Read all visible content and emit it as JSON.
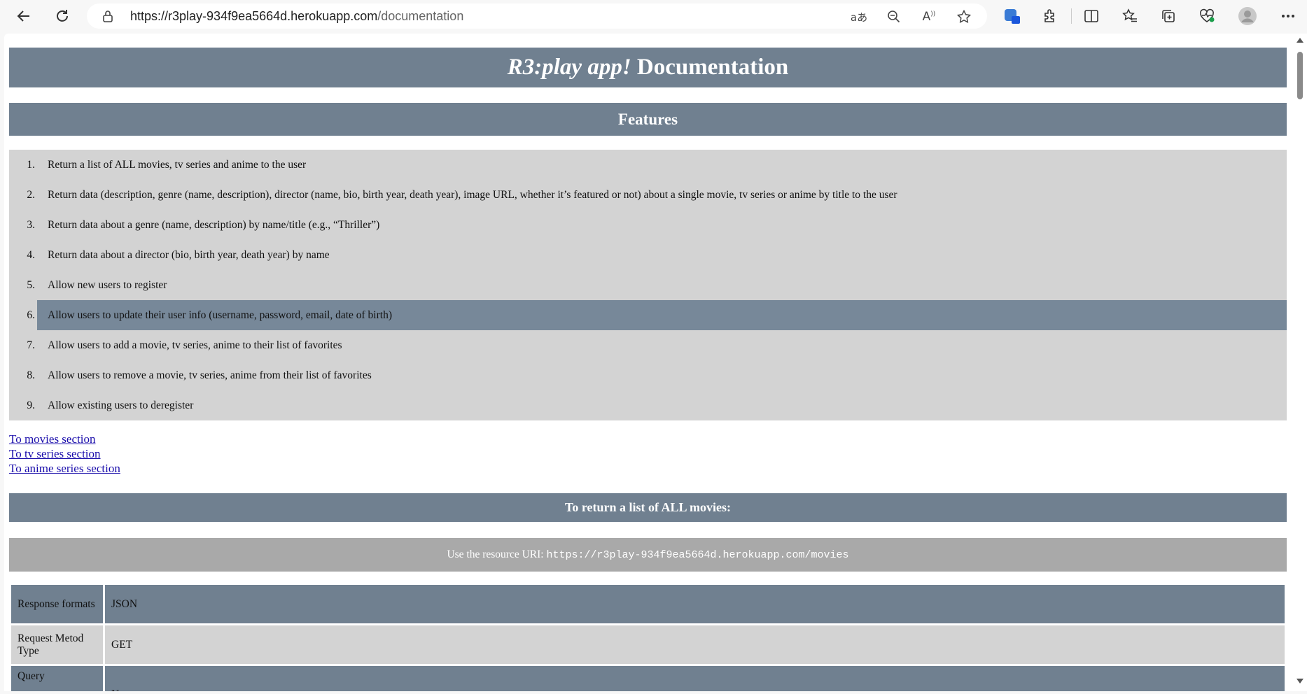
{
  "browser": {
    "url_host": "https://r3play-934f9ea5664d.herokuapp.com",
    "url_path": "/documentation"
  },
  "page": {
    "title_italic": "R3:play app!",
    "title_rest": " Documentation",
    "features_heading": "Features",
    "features": [
      {
        "num": "1.",
        "text": "Return a list of ALL movies, tv series and anime to the user"
      },
      {
        "num": "2.",
        "text": "Return data (description, genre (name, description), director (name, bio, birth year, death year), image URL, whether it’s featured or not) about a single movie, tv series or anime by title to the user"
      },
      {
        "num": "3.",
        "text": "Return data about a genre (name, description) by name/title (e.g., “Thriller”)"
      },
      {
        "num": "4.",
        "text": "Return data about a director (bio, birth year, death year) by name"
      },
      {
        "num": "5.",
        "text": "Allow new users to register"
      },
      {
        "num": "6.",
        "text": "Allow users to update their user info (username, password, email, date of birth)"
      },
      {
        "num": "7.",
        "text": "Allow users to add a movie, tv series, anime to their list of favorites"
      },
      {
        "num": "8.",
        "text": "Allow users to remove a movie, tv series, anime from their list of favorites"
      },
      {
        "num": "9.",
        "text": "Allow existing users to deregister"
      }
    ],
    "links": [
      "To movies section",
      "To tv series section",
      "To anime series section"
    ],
    "section_heading": "To return a list of ALL movies:",
    "uri_label": "Use the resource URI: ",
    "uri_value": "https://r3play-934f9ea5664d.herokuapp.com/movies",
    "spec_rows": [
      {
        "key": "Response formats",
        "value": "JSON"
      },
      {
        "key": "Request Metod Type",
        "value": "GET"
      },
      {
        "key": "Query",
        "value": "None"
      }
    ]
  },
  "colors": {
    "header_bg": "#708090",
    "list_bg": "#d3d3d3",
    "hover_bg": "#778899",
    "uri_bg": "#a9a9a9"
  }
}
